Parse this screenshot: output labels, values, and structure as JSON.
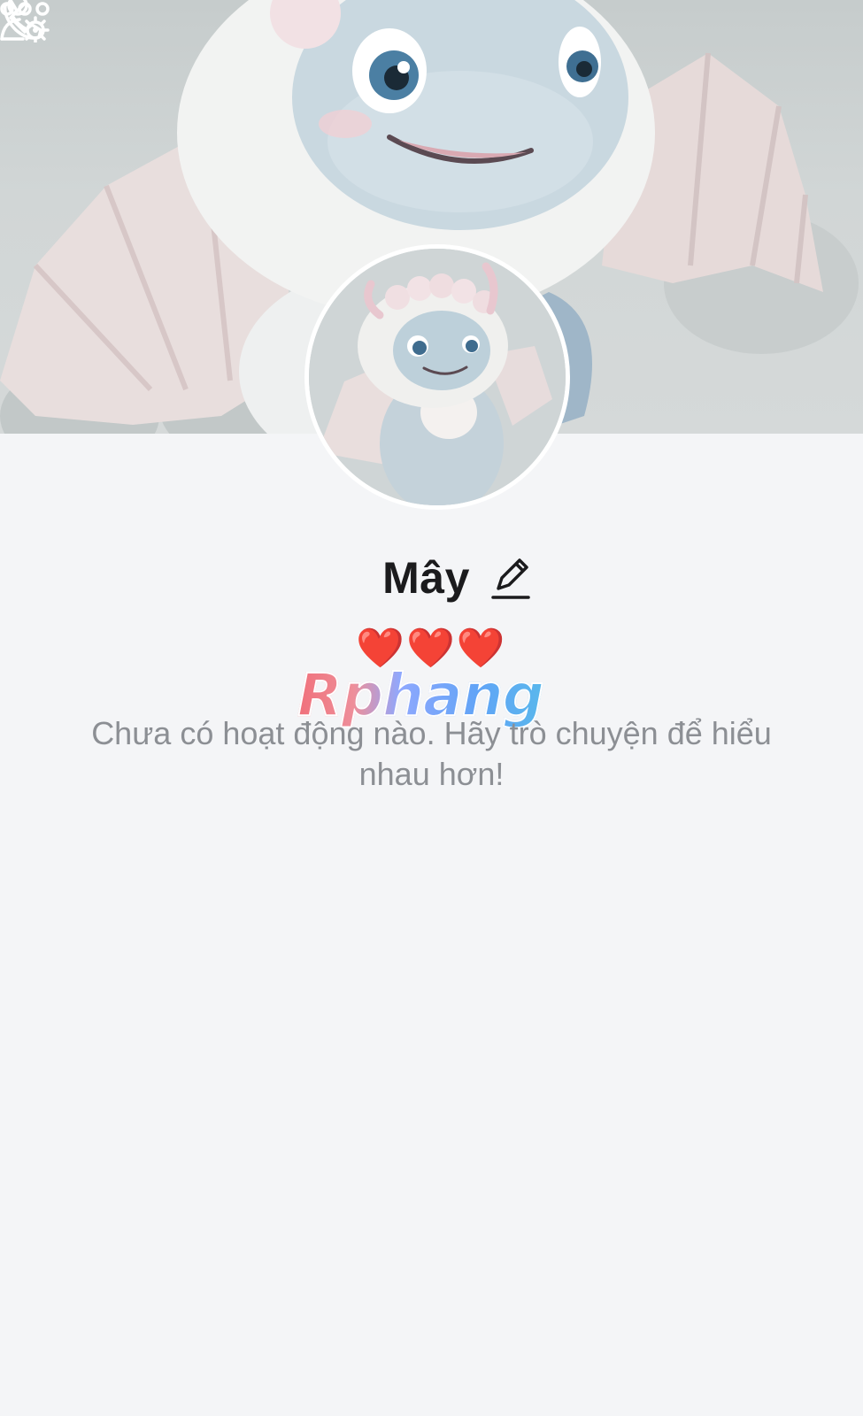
{
  "header": {
    "back_icon": "chevron-left-icon",
    "call_icon": "phone-icon",
    "settings_icon": "user-settings-icon",
    "more_icon": "more-dots-icon"
  },
  "profile": {
    "name": "Mây",
    "bio": "❤️❤️❤️",
    "edit_icon": "pencil-icon"
  },
  "watermark": {
    "text": "Rphang"
  },
  "feed": {
    "empty_message": "Chưa có hoạt động nào. Hãy trò chuyện để hiểu nhau hơn!"
  },
  "colors": {
    "background": "#f4f5f7",
    "name": "#1b1b1d",
    "empty_text": "#8c8f94",
    "heart": "#d11a1a"
  }
}
